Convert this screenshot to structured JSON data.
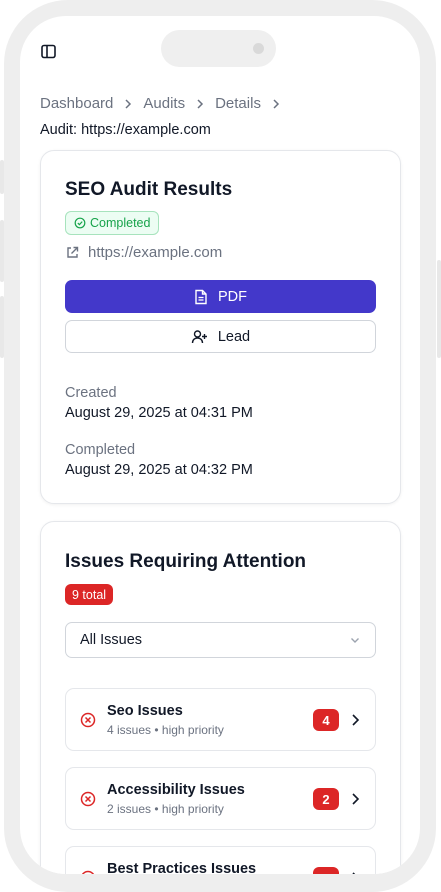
{
  "breadcrumb": [
    "Dashboard",
    "Audits",
    "Details"
  ],
  "audit_label": "Audit: https://example.com",
  "results_card": {
    "title": "SEO Audit Results",
    "status": "Completed",
    "url": "https://example.com",
    "pdf_label": "PDF",
    "lead_label": "Lead",
    "created_label": "Created",
    "created_value": "August 29, 2025 at 04:31 PM",
    "completed_label": "Completed",
    "completed_value": "August 29, 2025 at 04:32 PM"
  },
  "issues_card": {
    "title": "Issues Requiring Attention",
    "total": "9 total",
    "filter_value": "All Issues",
    "items": [
      {
        "title": "Seo Issues",
        "sub": "4 issues • high priority",
        "count": "4"
      },
      {
        "title": "Accessibility Issues",
        "sub": "2 issues • high priority",
        "count": "2"
      },
      {
        "title": "Best Practices Issues",
        "sub": "",
        "count": ""
      }
    ]
  },
  "colors": {
    "primary": "#4338ca",
    "success": "#16a34a",
    "danger": "#dc2626"
  },
  "icons": [
    "sidebar-toggle-icon",
    "chevron-right-icon",
    "check-circle-icon",
    "external-link-icon",
    "file-text-icon",
    "user-plus-icon",
    "chevron-down-icon",
    "x-circle-icon"
  ]
}
